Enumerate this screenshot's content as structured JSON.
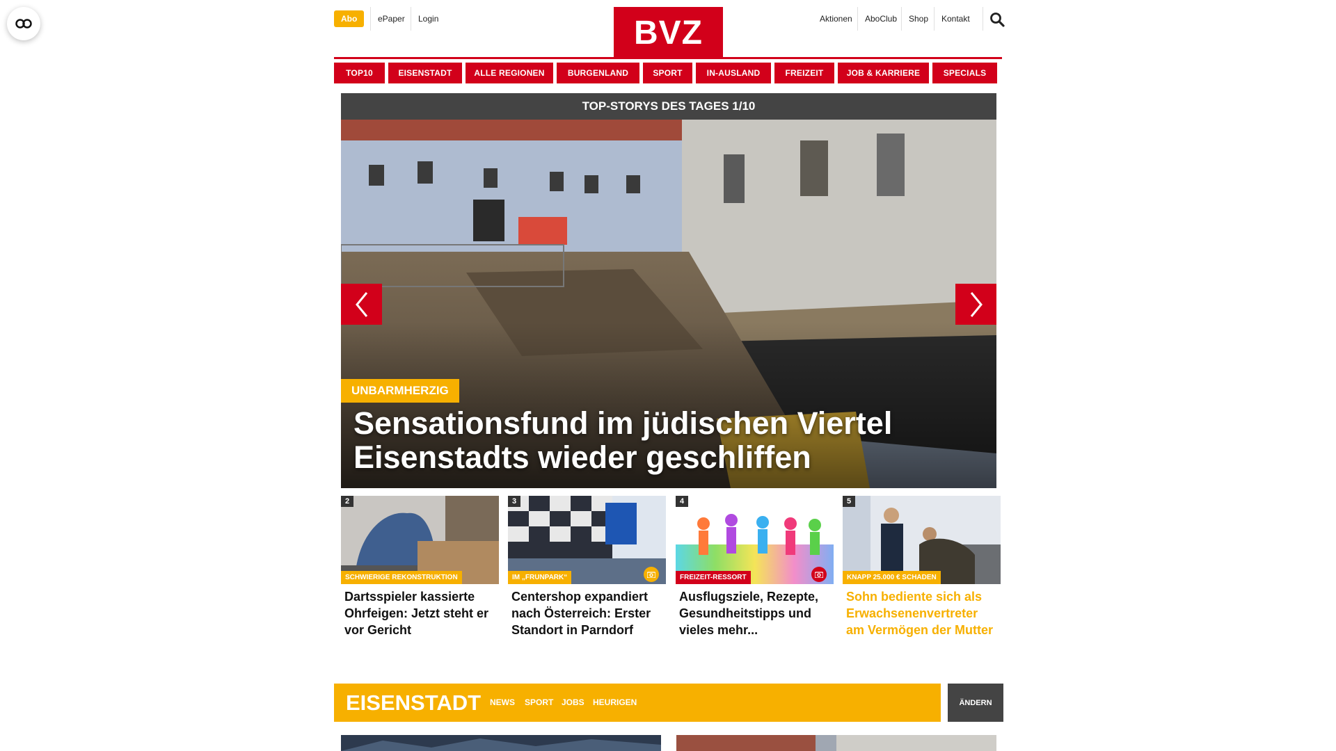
{
  "header": {
    "abo_label": "Abo",
    "epaper_label": "ePaper",
    "login_label": "Login",
    "logo_text": "BVZ",
    "right_links": [
      "Aktionen",
      "AboClub",
      "Shop",
      "Kontakt"
    ]
  },
  "nav": {
    "items": [
      "TOP10",
      "EISENSTADT",
      "ALLE REGIONEN",
      "BURGENLAND",
      "SPORT",
      "IN-AUSLAND",
      "FREIZEIT",
      "JOB & KARRIERE",
      "SPECIALS"
    ]
  },
  "hero": {
    "heading": "TOP-STORYS DES TAGES 1/10",
    "tag": "UNBARMHERZIG",
    "title_line1": "Sensationsfund im jüdischen Viertel",
    "title_line2": "Eisenstadts wieder geschliffen"
  },
  "stories": [
    {
      "num": "2",
      "tag": "SCHWIERIGE REKONSTRUKTION",
      "title": "Dartsspieler kassierte Ohrfeigen: Jetzt steht er vor Gericht"
    },
    {
      "num": "3",
      "tag": "IM „FRUNPARK“",
      "title": "Centershop expandiert nach Österreich: Erster Standort in Parndorf"
    },
    {
      "num": "4",
      "tag": "FREIZEIT-RESSORT",
      "title": "Ausflugsziele, Rezepte, Gesundheitstipps und vieles mehr..."
    },
    {
      "num": "5",
      "tag": "KNAPP 25.000 € SCHADEN",
      "title": "Sohn bediente sich als Erwachsenenvertreter am Vermögen der Mutter"
    }
  ],
  "section": {
    "title": "EISENSTADT",
    "links": [
      "NEWS",
      "SPORT",
      "JOBS",
      "HEURIGEN"
    ],
    "change_label": "ÄNDERN"
  },
  "colors": {
    "brand_red": "#d2001a",
    "accent_yellow": "#f7b000",
    "dark_gray": "#444444"
  }
}
